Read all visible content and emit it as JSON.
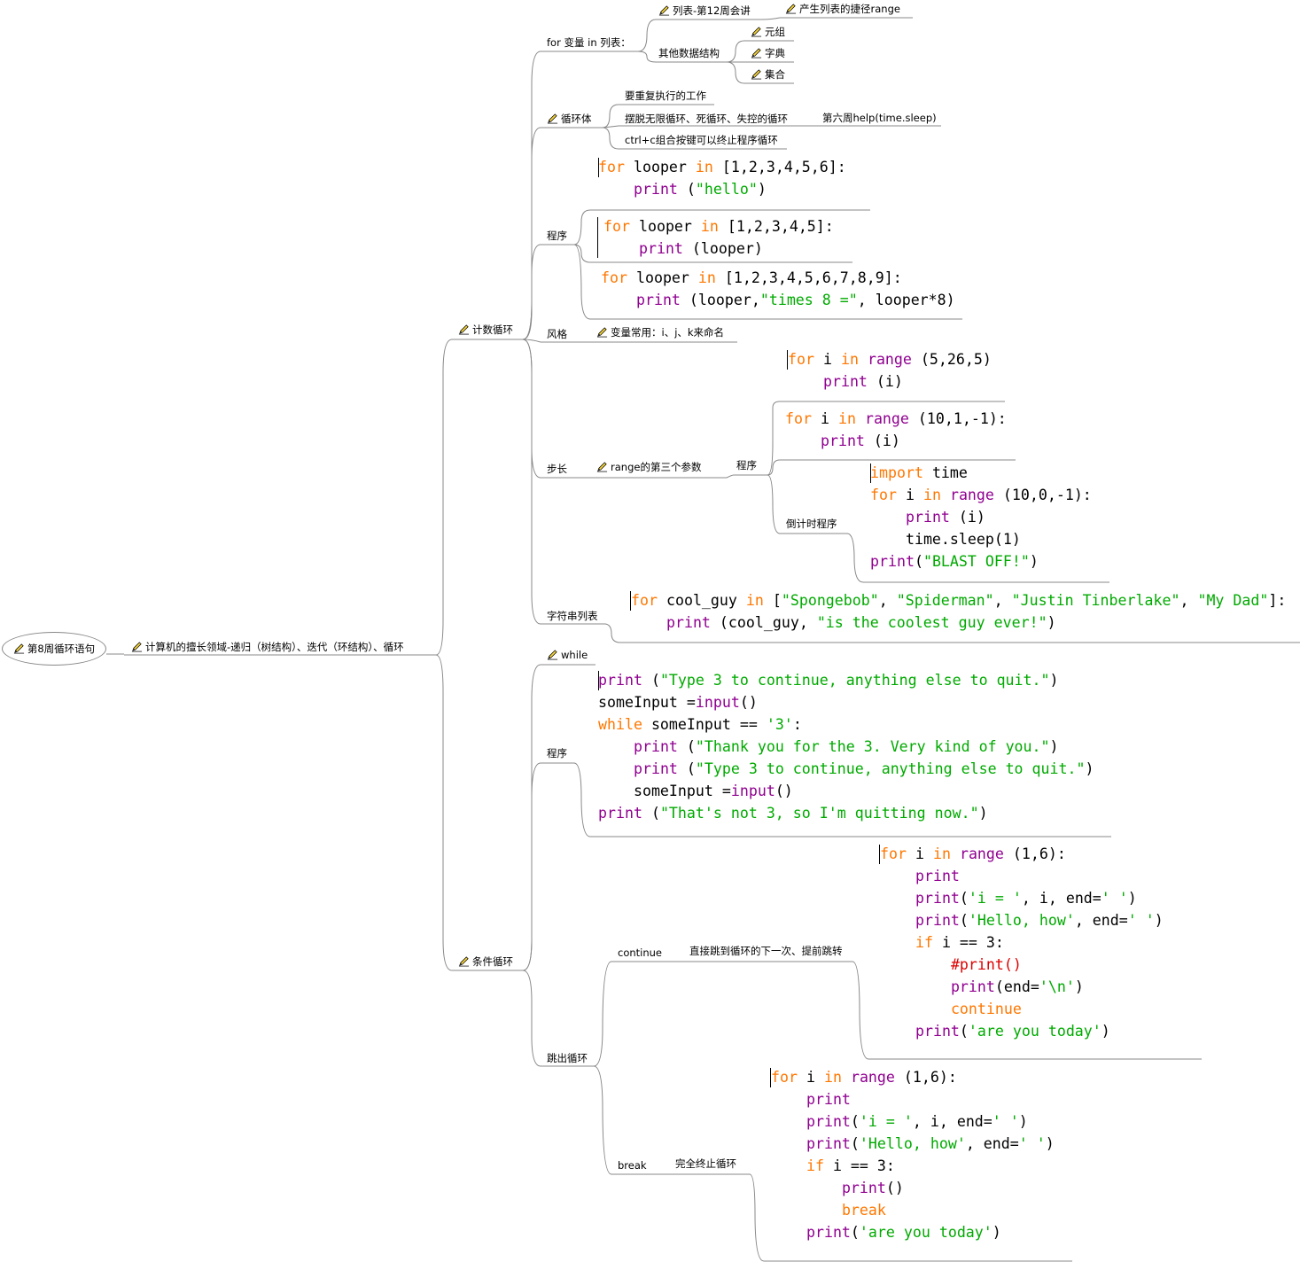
{
  "root": {
    "label": "第8周循环语句"
  },
  "main_branch": {
    "label": "计算机的擅长领域-递归（树结构）、迭代（环结构）、循环"
  },
  "counting_loop": {
    "label": "计数循环",
    "for_syntax": {
      "label": "for 变量 in 列表：",
      "list_topic": "列表-第12周会讲",
      "range_shortcut": "产生列表的捷径range",
      "other_structures": "其他数据结构",
      "tuple": "元组",
      "dict": "字典",
      "set": "集合"
    },
    "loop_body": {
      "label": "循环体",
      "item1": "要重复执行的工作",
      "item2": "摆脱无限循环、死循环、失控的循环",
      "item2_note": "第六周help(time.sleep)",
      "item3": "ctrl+c组合按键可以终止程序循环"
    },
    "program": {
      "label": "程序"
    },
    "style": {
      "label": "风格",
      "note": "变量常用：i、j、k来命名"
    },
    "step": {
      "label": "步长",
      "param": "range的第三个参数",
      "program_label": "程序",
      "countdown_label": "倒计时程序"
    },
    "string_list": {
      "label": "字符串列表"
    }
  },
  "conditional_loop": {
    "label": "条件循环",
    "while_label": "while",
    "program_label": "程序",
    "exit_loop": {
      "label": "跳出循环",
      "continue_label": "continue",
      "continue_desc": "直接跳到循环的下一次、提前跳转",
      "break_label": "break",
      "break_desc": "完全终止循环"
    }
  },
  "icons": {
    "node": "pencil-icon"
  },
  "colors": {
    "keyword": "#ff7700",
    "builtin": "#900090",
    "string": "#00aa00",
    "comment": "#dd0000",
    "link": "#888888"
  },
  "code_blocks": {
    "hello": [
      [
        [
          "for",
          "kw"
        ],
        [
          " looper ",
          ""
        ],
        [
          "in",
          "kw"
        ],
        [
          " [1,2,3,4,5,6]:",
          ""
        ]
      ],
      [
        [
          "    ",
          ""
        ],
        [
          "print",
          "bi"
        ],
        [
          " (",
          ""
        ],
        [
          "\"hello\"",
          "st"
        ],
        [
          ")",
          ""
        ]
      ]
    ],
    "looper": [
      [
        [
          "for",
          "kw"
        ],
        [
          " looper ",
          ""
        ],
        [
          "in",
          "kw"
        ],
        [
          " [1,2,3,4,5]:",
          ""
        ]
      ],
      [
        [
          "    ",
          ""
        ],
        [
          "print",
          "bi"
        ],
        [
          " (looper)",
          ""
        ]
      ]
    ],
    "times8": [
      [
        [
          "for",
          "kw"
        ],
        [
          " looper ",
          ""
        ],
        [
          "in",
          "kw"
        ],
        [
          " [1,2,3,4,5,6,7,8,9]:",
          ""
        ]
      ],
      [
        [
          "    ",
          ""
        ],
        [
          "print",
          "bi"
        ],
        [
          " (looper,",
          ""
        ],
        [
          "\"times 8 =\"",
          "st"
        ],
        [
          ", looper*8)",
          ""
        ]
      ]
    ],
    "range_up": [
      [
        [
          "for",
          "kw"
        ],
        [
          " i ",
          ""
        ],
        [
          "in",
          "kw"
        ],
        [
          " ",
          ""
        ],
        [
          "range",
          "bi"
        ],
        [
          " (5,26,5)",
          ""
        ]
      ],
      [
        [
          "    ",
          ""
        ],
        [
          "print",
          "bi"
        ],
        [
          " (i)",
          ""
        ]
      ]
    ],
    "range_down": [
      [
        [
          "for",
          "kw"
        ],
        [
          " i ",
          ""
        ],
        [
          "in",
          "kw"
        ],
        [
          " ",
          ""
        ],
        [
          "range",
          "bi"
        ],
        [
          " (10,1,-1):",
          ""
        ]
      ],
      [
        [
          "    ",
          ""
        ],
        [
          "print",
          "bi"
        ],
        [
          " (i)",
          ""
        ]
      ]
    ],
    "countdown": [
      [
        [
          "import",
          "kw"
        ],
        [
          " time",
          ""
        ]
      ],
      [
        [
          "for",
          "kw"
        ],
        [
          " i ",
          ""
        ],
        [
          "in",
          "kw"
        ],
        [
          " ",
          ""
        ],
        [
          "range",
          "bi"
        ],
        [
          " (10,0,-1):",
          ""
        ]
      ],
      [
        [
          "    ",
          ""
        ],
        [
          "print",
          "bi"
        ],
        [
          " (i)",
          ""
        ]
      ],
      [
        [
          "    time.sleep(1)",
          ""
        ]
      ],
      [
        [
          "print",
          "bi"
        ],
        [
          "(",
          ""
        ],
        [
          "\"BLAST OFF!\"",
          "st"
        ],
        [
          ")",
          ""
        ]
      ]
    ],
    "cool_guy": [
      [
        [
          "for",
          "kw"
        ],
        [
          " cool_guy ",
          ""
        ],
        [
          "in",
          "kw"
        ],
        [
          " [",
          ""
        ],
        [
          "\"Spongebob\"",
          "st"
        ],
        [
          ", ",
          ""
        ],
        [
          "\"Spiderman\"",
          "st"
        ],
        [
          ", ",
          ""
        ],
        [
          "\"Justin Tinberlake\"",
          "st"
        ],
        [
          ", ",
          ""
        ],
        [
          "\"My Dad\"",
          "st"
        ],
        [
          "]:",
          ""
        ]
      ],
      [
        [
          "    ",
          ""
        ],
        [
          "print",
          "bi"
        ],
        [
          " (cool_guy, ",
          ""
        ],
        [
          "\"is the coolest guy ever!\"",
          "st"
        ],
        [
          ")",
          ""
        ]
      ]
    ],
    "while_prog": [
      [
        [
          "print",
          "bi"
        ],
        [
          " (",
          ""
        ],
        [
          "\"Type 3 to continue, anything else to quit.\"",
          "st"
        ],
        [
          ")",
          ""
        ]
      ],
      [
        [
          "someInput =",
          ""
        ],
        [
          "input",
          "bi"
        ],
        [
          "()",
          ""
        ]
      ],
      [
        [
          "while",
          "kw"
        ],
        [
          " someInput == ",
          ""
        ],
        [
          "'3'",
          "st"
        ],
        [
          ":",
          ""
        ]
      ],
      [
        [
          "    ",
          ""
        ],
        [
          "print",
          "bi"
        ],
        [
          " (",
          ""
        ],
        [
          "\"Thank you for the 3. Very kind of you.\"",
          "st"
        ],
        [
          ")",
          ""
        ]
      ],
      [
        [
          "    ",
          ""
        ],
        [
          "print",
          "bi"
        ],
        [
          " (",
          ""
        ],
        [
          "\"Type 3 to continue, anything else to quit.\"",
          "st"
        ],
        [
          ")",
          ""
        ]
      ],
      [
        [
          "    someInput =",
          ""
        ],
        [
          "input",
          "bi"
        ],
        [
          "()",
          ""
        ]
      ],
      [
        [
          "print",
          "bi"
        ],
        [
          " (",
          ""
        ],
        [
          "\"That's not 3, so I'm quitting now.\"",
          "st"
        ],
        [
          ")",
          ""
        ]
      ]
    ],
    "continue_prog": [
      [
        [
          "for",
          "kw"
        ],
        [
          " i ",
          ""
        ],
        [
          "in",
          "kw"
        ],
        [
          " ",
          ""
        ],
        [
          "range",
          "bi"
        ],
        [
          " (1,6):",
          ""
        ]
      ],
      [
        [
          "    ",
          ""
        ],
        [
          "print",
          "bi"
        ]
      ],
      [
        [
          "    ",
          ""
        ],
        [
          "print",
          "bi"
        ],
        [
          "(",
          ""
        ],
        [
          "'i = '",
          "st"
        ],
        [
          ", i, end=",
          ""
        ],
        [
          "' '",
          "st"
        ],
        [
          ")",
          ""
        ]
      ],
      [
        [
          "    ",
          ""
        ],
        [
          "print",
          "bi"
        ],
        [
          "(",
          ""
        ],
        [
          "'Hello, how'",
          "st"
        ],
        [
          ", end=",
          ""
        ],
        [
          "' '",
          "st"
        ],
        [
          ")",
          ""
        ]
      ],
      [
        [
          "    ",
          ""
        ],
        [
          "if",
          "kw"
        ],
        [
          " i == 3:",
          ""
        ]
      ],
      [
        [
          "        ",
          ""
        ],
        [
          "#print()",
          "cm"
        ]
      ],
      [
        [
          "        ",
          ""
        ],
        [
          "print",
          "bi"
        ],
        [
          "(end=",
          ""
        ],
        [
          "'\\n'",
          "st"
        ],
        [
          ")",
          ""
        ]
      ],
      [
        [
          "        ",
          ""
        ],
        [
          "continue",
          "kw"
        ]
      ],
      [
        [
          "    ",
          ""
        ],
        [
          "print",
          "bi"
        ],
        [
          "(",
          ""
        ],
        [
          "'are you today'",
          "st"
        ],
        [
          ")",
          ""
        ]
      ]
    ],
    "break_prog": [
      [
        [
          "for",
          "kw"
        ],
        [
          " i ",
          ""
        ],
        [
          "in",
          "kw"
        ],
        [
          " ",
          ""
        ],
        [
          "range",
          "bi"
        ],
        [
          " (1,6):",
          ""
        ]
      ],
      [
        [
          "    ",
          ""
        ],
        [
          "print",
          "bi"
        ]
      ],
      [
        [
          "    ",
          ""
        ],
        [
          "print",
          "bi"
        ],
        [
          "(",
          ""
        ],
        [
          "'i = '",
          "st"
        ],
        [
          ", i, end=",
          ""
        ],
        [
          "' '",
          "st"
        ],
        [
          ")",
          ""
        ]
      ],
      [
        [
          "    ",
          ""
        ],
        [
          "print",
          "bi"
        ],
        [
          "(",
          ""
        ],
        [
          "'Hello, how'",
          "st"
        ],
        [
          ", end=",
          ""
        ],
        [
          "' '",
          "st"
        ],
        [
          ")",
          ""
        ]
      ],
      [
        [
          "    ",
          ""
        ],
        [
          "if",
          "kw"
        ],
        [
          " i == 3:",
          ""
        ]
      ],
      [
        [
          "        ",
          ""
        ],
        [
          "print",
          "bi"
        ],
        [
          "()",
          ""
        ]
      ],
      [
        [
          "        ",
          ""
        ],
        [
          "break",
          "kw"
        ]
      ],
      [
        [
          "    ",
          ""
        ],
        [
          "print",
          "bi"
        ],
        [
          "(",
          ""
        ],
        [
          "'are you today'",
          "st"
        ],
        [
          ")",
          ""
        ]
      ]
    ]
  }
}
